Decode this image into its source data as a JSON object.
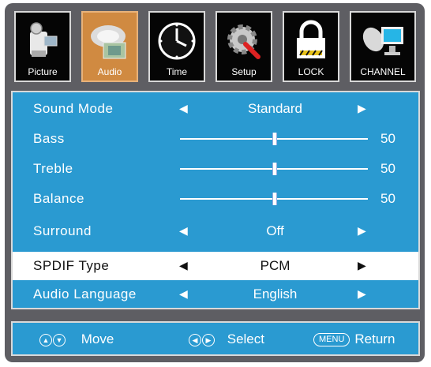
{
  "tabs": [
    {
      "label": "Picture",
      "icon": "camcorder-icon",
      "active": false
    },
    {
      "label": "Audio",
      "icon": "speaker-icon",
      "active": true
    },
    {
      "label": "Time",
      "icon": "clock-icon",
      "active": false
    },
    {
      "label": "Setup",
      "icon": "gear-wrench-icon",
      "active": false
    },
    {
      "label": "LOCK",
      "icon": "padlock-icon",
      "active": false
    },
    {
      "label": "CHANNEL",
      "icon": "satellite-tv-icon",
      "active": false
    }
  ],
  "settings": {
    "sound_mode": {
      "label": "Sound Mode",
      "value": "Standard"
    },
    "bass": {
      "label": "Bass",
      "value": "50",
      "level": 0.5
    },
    "treble": {
      "label": "Treble",
      "value": "50",
      "level": 0.5
    },
    "balance": {
      "label": "Balance",
      "value": "50",
      "level": 0.5
    },
    "surround": {
      "label": "Surround",
      "value": "Off"
    },
    "spdif_type": {
      "label": "SPDIF Type",
      "value": "PCM",
      "selected": true
    },
    "audio_language": {
      "label": "Audio Language",
      "value": "English"
    }
  },
  "footer": {
    "move": "Move",
    "select": "Select",
    "menu_key": "MENU",
    "return": "Return"
  },
  "colors": {
    "panel": "#2a9ad1",
    "active_tab": "#d08a41",
    "frame": "#5e5e63"
  }
}
